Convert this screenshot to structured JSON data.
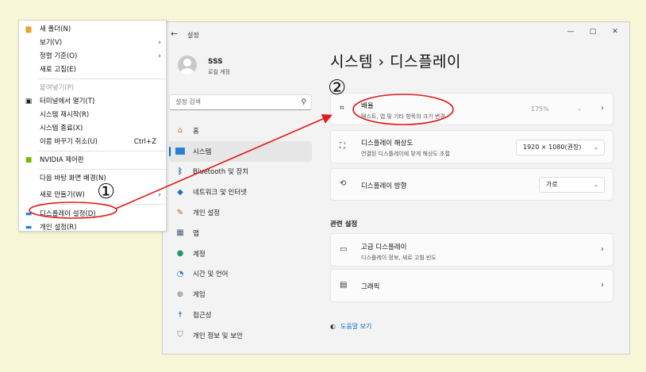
{
  "window": {
    "back_icon": "back-arrow-icon",
    "title": "설정",
    "controls": [
      "—",
      "▢",
      "✕"
    ]
  },
  "user": {
    "name": "SSS",
    "subtitle": "로컬 계정"
  },
  "search": {
    "placeholder": "설정 검색"
  },
  "nav": [
    {
      "label": "홈",
      "icon": "home-icon"
    },
    {
      "label": "시스템",
      "icon": "system-icon"
    },
    {
      "label": "Bluetooth 및 장치",
      "icon": "bluetooth-icon"
    },
    {
      "label": "네트워크 및 인터넷",
      "icon": "network-icon"
    },
    {
      "label": "개인 설정",
      "icon": "brush-icon"
    },
    {
      "label": "앱",
      "icon": "apps-icon"
    },
    {
      "label": "계정",
      "icon": "account-icon"
    },
    {
      "label": "시간 및 언어",
      "icon": "clock-globe-icon"
    },
    {
      "label": "게임",
      "icon": "gamepad-icon"
    },
    {
      "label": "접근성",
      "icon": "accessibility-icon"
    },
    {
      "label": "개인 정보 및 보안",
      "icon": "shield-icon"
    }
  ],
  "page": {
    "title": "시스템  ›  디스플레이"
  },
  "cards": {
    "scale": {
      "label": "배율",
      "desc": "텍스트, 앱 및 기타 항목의 크기 변경",
      "value": "175%"
    },
    "resolution": {
      "label": "디스플레이 해상도",
      "desc": "연결된 디스플레이에 맞게 해상도 조절",
      "value": "1920 × 1080(권장)"
    },
    "orientation": {
      "label": "디스플레이 방향",
      "value": "가로"
    }
  },
  "related": {
    "heading": "관련 설정",
    "advanced": {
      "label": "고급 디스플레이",
      "desc": "디스플레이 정보, 새로 고침 빈도"
    },
    "graphics": {
      "label": "그래픽"
    }
  },
  "help": {
    "label": "도움말 보기"
  },
  "context_menu": {
    "items": [
      {
        "label": "새 폴더(N)",
        "icon": "folder-icon"
      },
      {
        "label": "보기(V)",
        "submenu": "›"
      },
      {
        "label": "정렬 기준(O)",
        "submenu": "›"
      },
      {
        "label": "새로 고침(E)"
      },
      {
        "label": "붙여넣기(P)",
        "disabled": true
      },
      {
        "label": "터미널에서 열기(T)",
        "icon": "terminal-icon"
      },
      {
        "label": "시스템 재시작(R)"
      },
      {
        "label": "시스템 종료(X)"
      },
      {
        "label": "이름 바꾸기 취소(U)",
        "shortcut": "Ctrl+Z"
      },
      {
        "label": "NVIDIA 제어판",
        "icon": "nvidia-icon"
      },
      {
        "label": "다음 바탕 화면 배경(N)"
      },
      {
        "label": "새로 만들기(W)",
        "submenu": "›"
      },
      {
        "label": "디스플레이 설정(D)",
        "icon": "display-settings-icon"
      },
      {
        "label": "개인 설정(R)",
        "icon": "personalize-icon"
      }
    ]
  },
  "annotations": {
    "step1": "①",
    "step2": "②",
    "color": "#e0191b"
  },
  "colors": {
    "accent": "#0067c0",
    "background": "#f7f6d7"
  }
}
